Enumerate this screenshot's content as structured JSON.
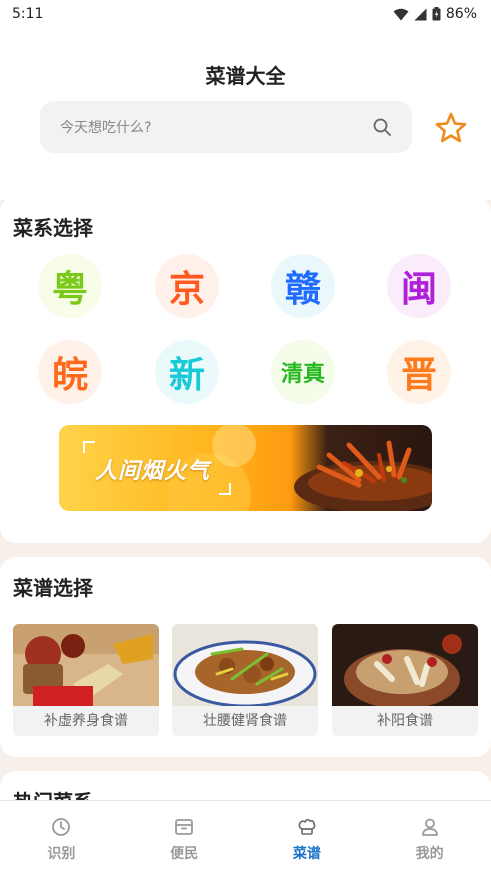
{
  "status_bar": {
    "time": "5:11",
    "battery": "86%"
  },
  "header": {
    "title": "菜谱大全"
  },
  "search": {
    "placeholder": "今天想吃什么?"
  },
  "cuisine_section": {
    "title": "菜系选择",
    "items": [
      {
        "label": "粤",
        "color": "#7bc919",
        "bg": "#f7fde8"
      },
      {
        "label": "京",
        "color": "#ff5a1f",
        "bg": "#fff0ea"
      },
      {
        "label": "赣",
        "color": "#1f6bff",
        "bg": "#eaf7fb"
      },
      {
        "label": "闽",
        "color": "#b020d8",
        "bg": "#faecfb"
      },
      {
        "label": "皖",
        "color": "#ff6a1a",
        "bg": "#fff1e8"
      },
      {
        "label": "新",
        "color": "#1ac9d8",
        "bg": "#eafafb"
      },
      {
        "label": "清真",
        "color": "#28b820",
        "bg": "#f3fdea"
      },
      {
        "label": "晋",
        "color": "#ff7a1a",
        "bg": "#fff3e8"
      }
    ],
    "banner_text": "人间烟火气"
  },
  "recipe_section": {
    "title": "菜谱选择",
    "items": [
      {
        "label": "补虚养身食谱",
        "tint": "#b97a3a"
      },
      {
        "label": "壮腰健肾食谱",
        "tint": "#a56a30"
      },
      {
        "label": "补阳食谱",
        "tint": "#7a3a1e"
      }
    ]
  },
  "hot_section": {
    "title": "热门菜系"
  },
  "tabs": [
    {
      "label": "识别",
      "icon": "scan-icon",
      "active": false
    },
    {
      "label": "便民",
      "icon": "box-icon",
      "active": false
    },
    {
      "label": "菜谱",
      "icon": "chef-hat-icon",
      "active": true
    },
    {
      "label": "我的",
      "icon": "user-icon",
      "active": false
    }
  ],
  "colors": {
    "accent": "#1a73c9",
    "star": "#f08a1c"
  }
}
